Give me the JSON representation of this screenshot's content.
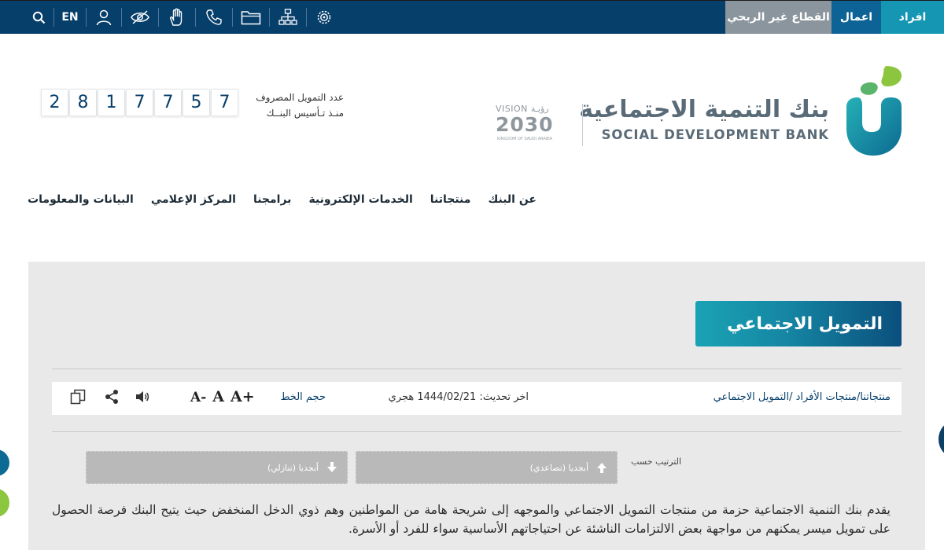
{
  "topbar": {
    "language_toggle": "EN",
    "icons": [
      "search-icon",
      "user-icon",
      "accessibility-hide-icon",
      "sign-language-icon",
      "phone-icon",
      "folder-icon",
      "sitemap-icon",
      "settings-icon"
    ],
    "sector_tabs": [
      {
        "label": "افراد",
        "color": "#1597b4"
      },
      {
        "label": "اعمال",
        "color": "#0d6296"
      },
      {
        "label": "القطاع غير الربحي",
        "color": "#8a959e"
      }
    ]
  },
  "brand": {
    "name_ar": "بنك التنمية الاجتماعية",
    "name_en": "SOCIAL DEVELOPMENT BANK",
    "vision_top": "VISION رؤيـة",
    "vision_year": "2030",
    "vision_sub": "KINGDOM OF SAUDI ARABIA"
  },
  "counter": {
    "digits": [
      "2",
      "8",
      "1",
      "7",
      "7",
      "5",
      "7"
    ],
    "label_line1": "عدد التمويل المصروف",
    "label_line2": "منـذ تـأسيس البنــك"
  },
  "nav": {
    "items": [
      "عن البنك",
      "منتجاتنا",
      "الخدمات الإلكترونية",
      "برامجنا",
      "المركز الإعلامي",
      "البيانات والمعلومات"
    ]
  },
  "page": {
    "title": "التمويل الاجتماعي",
    "breadcrumb": "منتجاتنا/منتجات الأفراد /التمويل الاجتماعي",
    "updated": "اخر تحديث: 1444/02/21 هجري",
    "font_size_label": "حجم الخط",
    "font_increase": "A+",
    "font_normal": "A",
    "font_decrease": "A-",
    "sort_label": "الترتيب حسب",
    "sort_asc": "أبجديا (تصاعدي)",
    "sort_desc": "أبجديا (تنازلي)",
    "description": "يقدم بنك التنمية الاجتماعية حزمة من منتجات التمويل الاجتماعي والموجهه إلى شريحة هامة من المواطنين وهم ذوي الدخل المنخفض حيث يتيح البنك فرصة الحصول على تمويل ميسر يمكنهم من مواجهة بعض الالتزامات الناشئة عن احتياجاتهم الأساسية سواء للفرد أو الأسرة."
  },
  "colors": {
    "topbar": "#073f6b",
    "accent_teal": "#1aa3b4",
    "content_bg": "#e9e9ea"
  }
}
